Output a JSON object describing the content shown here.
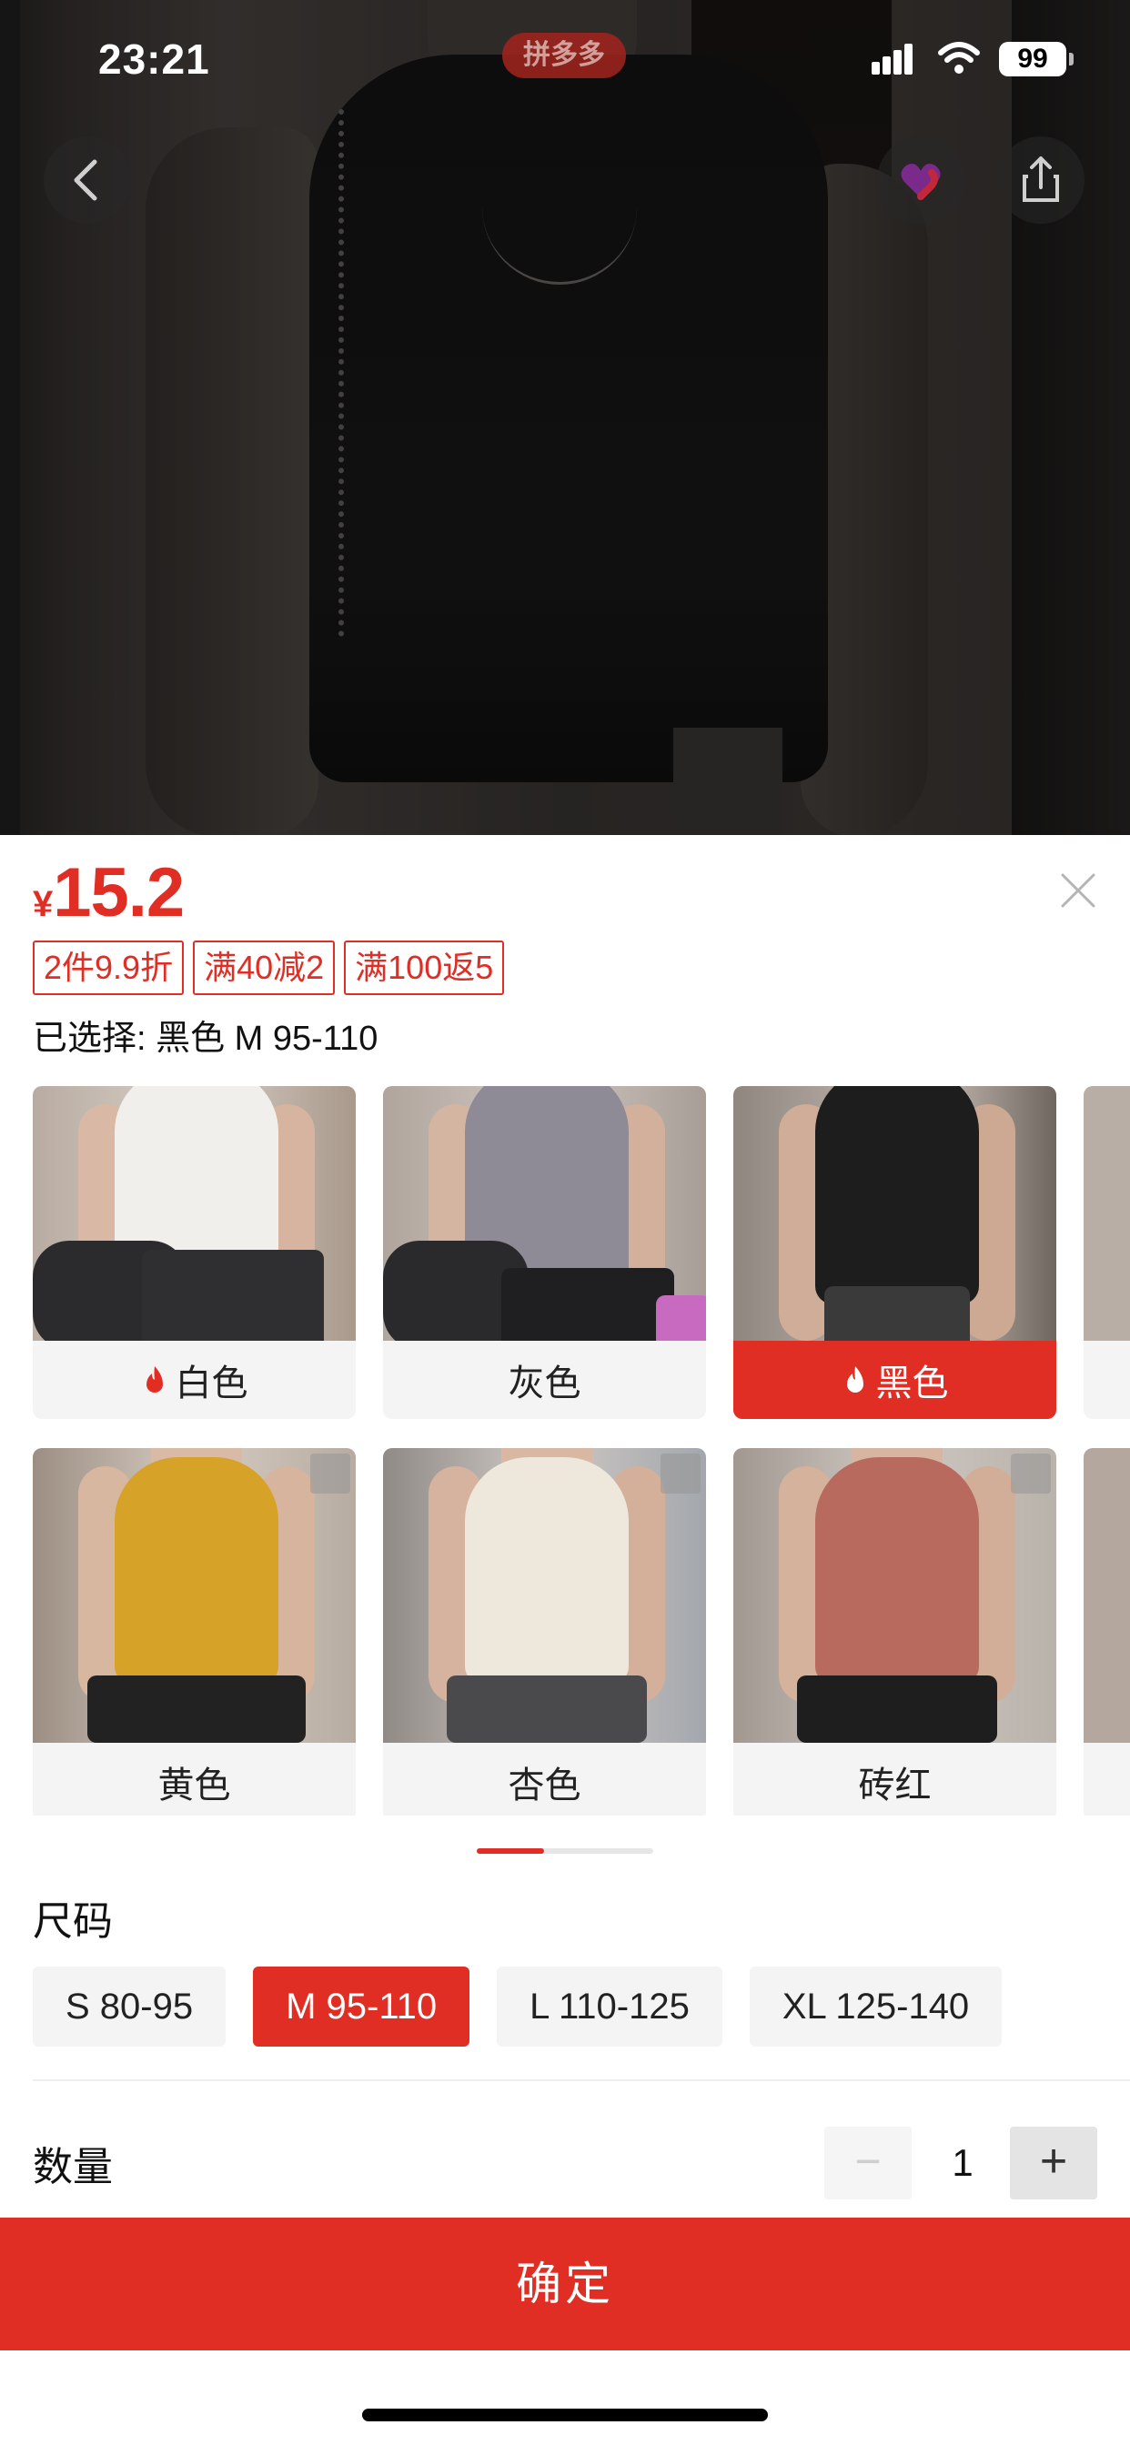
{
  "status_bar": {
    "time": "23:21",
    "app_pill": "拼多多",
    "battery": "99"
  },
  "icons": {
    "back": "chevron-left-icon",
    "favorite": "heart-icon",
    "share": "share-icon",
    "close": "close-icon",
    "hot": "flame-icon",
    "expand": "expand-icon"
  },
  "product": {
    "currency_symbol": "¥",
    "price": "15.2",
    "promo_tags": [
      "2件9.9折",
      "满40减2",
      "满100返5"
    ],
    "selected_summary": "已选择: 黑色 M 95-110"
  },
  "colors": {
    "options": [
      {
        "label": "白色",
        "hot": true,
        "selected": false
      },
      {
        "label": "灰色",
        "hot": false,
        "selected": false
      },
      {
        "label": "黑色",
        "hot": true,
        "selected": true
      },
      {
        "label": "黄色",
        "hot": false,
        "selected": false
      },
      {
        "label": "杏色",
        "hot": false,
        "selected": false
      },
      {
        "label": "砖红",
        "hot": false,
        "selected": false
      }
    ],
    "scroll_progress_fraction": 0.38
  },
  "size": {
    "title": "尺码",
    "options": [
      "S 80-95",
      "M 95-110",
      "L 110-125",
      "XL 125-140"
    ],
    "selected": "M 95-110"
  },
  "quantity": {
    "title": "数量",
    "minus": "−",
    "value": "1",
    "plus": "+"
  },
  "confirm_button": "确定",
  "theme": {
    "accent": "#e02e24",
    "chip_bg": "#f4f4f4"
  }
}
